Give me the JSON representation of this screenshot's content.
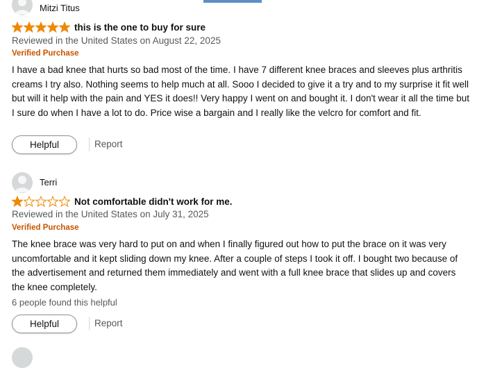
{
  "reviews": [
    {
      "reviewer": "Mitzi Titus",
      "rating": 5,
      "title": "this is the one to buy for sure",
      "meta": "Reviewed in the United States on August 22, 2025",
      "verified": "Verified Purchase",
      "body": "I have a bad knee that hurts so bad most of the time. I have 7 different knee braces and sleeves plus arthritis creams I try also. Nothing seems to help much at all. Sooo I decided to give it a try and to my surprise it fit well but will it help with the pain and YES it does!! Very happy I went on and bought it. I don't wear it all the time but I sure do when I have a lot to do. Price wise a bargain and I really like the velcro for comfort and fit.",
      "helpful_label": "Helpful",
      "report_label": "Report"
    },
    {
      "reviewer": "Terri",
      "rating": 1,
      "title": "Not comfortable didn't work for me.",
      "meta": "Reviewed in the United States on July 31, 2025",
      "verified": "Verified Purchase",
      "body": "The knee brace was very hard to put on and when I finally figured out how to put the brace on it was very uncomfortable and it kept sliding down my knee. After a couple of steps I took it off. I bought two because of the advertisement and returned them immediately and went with a full knee brace that slides up and covers the knee completely.",
      "helpful_count": "6 people found this helpful",
      "helpful_label": "Helpful",
      "report_label": "Report"
    }
  ],
  "colors": {
    "star": "#f08804",
    "verified": "#c45500",
    "secondary_text": "#565959"
  }
}
